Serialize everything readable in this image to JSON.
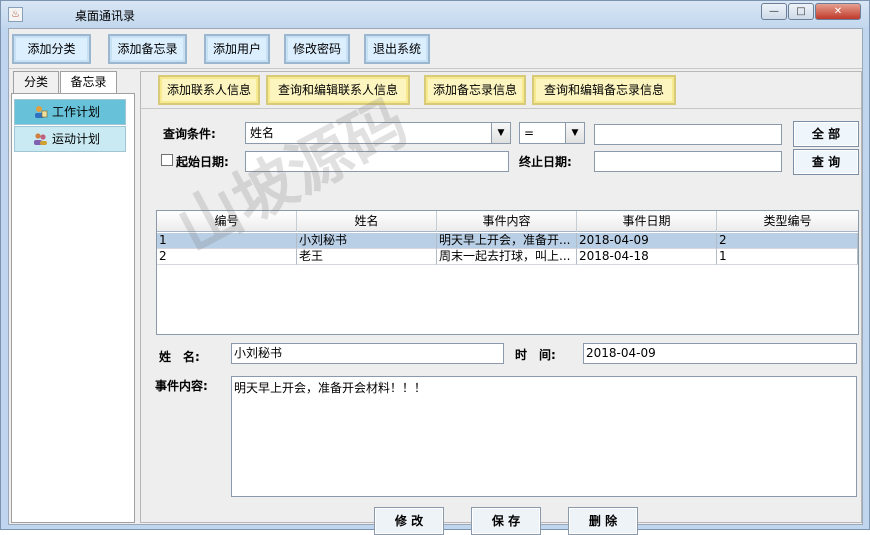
{
  "window": {
    "title": "桌面通讯录",
    "controls": {
      "minimize": "—",
      "maximize": "□",
      "close": "✕"
    }
  },
  "toolbar": [
    {
      "label": "添加分类"
    },
    {
      "label": "添加备忘录"
    },
    {
      "label": "添加用户"
    },
    {
      "label": "修改密码"
    },
    {
      "label": "退出系统"
    }
  ],
  "left_tabs": [
    {
      "label": "分类"
    },
    {
      "label": "备忘录"
    }
  ],
  "memo_categories": [
    {
      "label": "工作计划",
      "selected": true
    },
    {
      "label": "运动计划",
      "selected": false
    }
  ],
  "subbar": [
    {
      "label": "添加联系人信息"
    },
    {
      "label": "查询和编辑联系人信息"
    },
    {
      "label": "添加备忘录信息"
    },
    {
      "label": "查询和编辑备忘录信息"
    }
  ],
  "query": {
    "condition_label": "查询条件:",
    "field_select": "姓名",
    "operator_select": "=",
    "value": "",
    "all_button": "全 部",
    "start_date_label": "起始日期:",
    "start_date_value": "",
    "end_date_label": "终止日期:",
    "end_date_value": "",
    "search_button": "查 询"
  },
  "table": {
    "headers": [
      "编号",
      "姓名",
      "事件内容",
      "事件日期",
      "类型编号"
    ],
    "rows": [
      {
        "cells": [
          "1",
          "小刘秘书",
          "明天早上开会，准备开...",
          "2018-04-09",
          "2"
        ],
        "selected": true
      },
      {
        "cells": [
          "2",
          "老王",
          "周末一起去打球，叫上...",
          "2018-04-18",
          "1"
        ],
        "selected": false
      }
    ]
  },
  "detail": {
    "name_label": "姓　名:",
    "name_value": "小刘秘书",
    "time_label": "时　间:",
    "time_value": "2018-04-09",
    "content_label": "事件内容:",
    "content_value": "明天早上开会，准备开会材料！！！"
  },
  "actions": {
    "edit": "修 改",
    "save": "保 存",
    "delete": "删 除"
  },
  "watermark": "山坡源码"
}
